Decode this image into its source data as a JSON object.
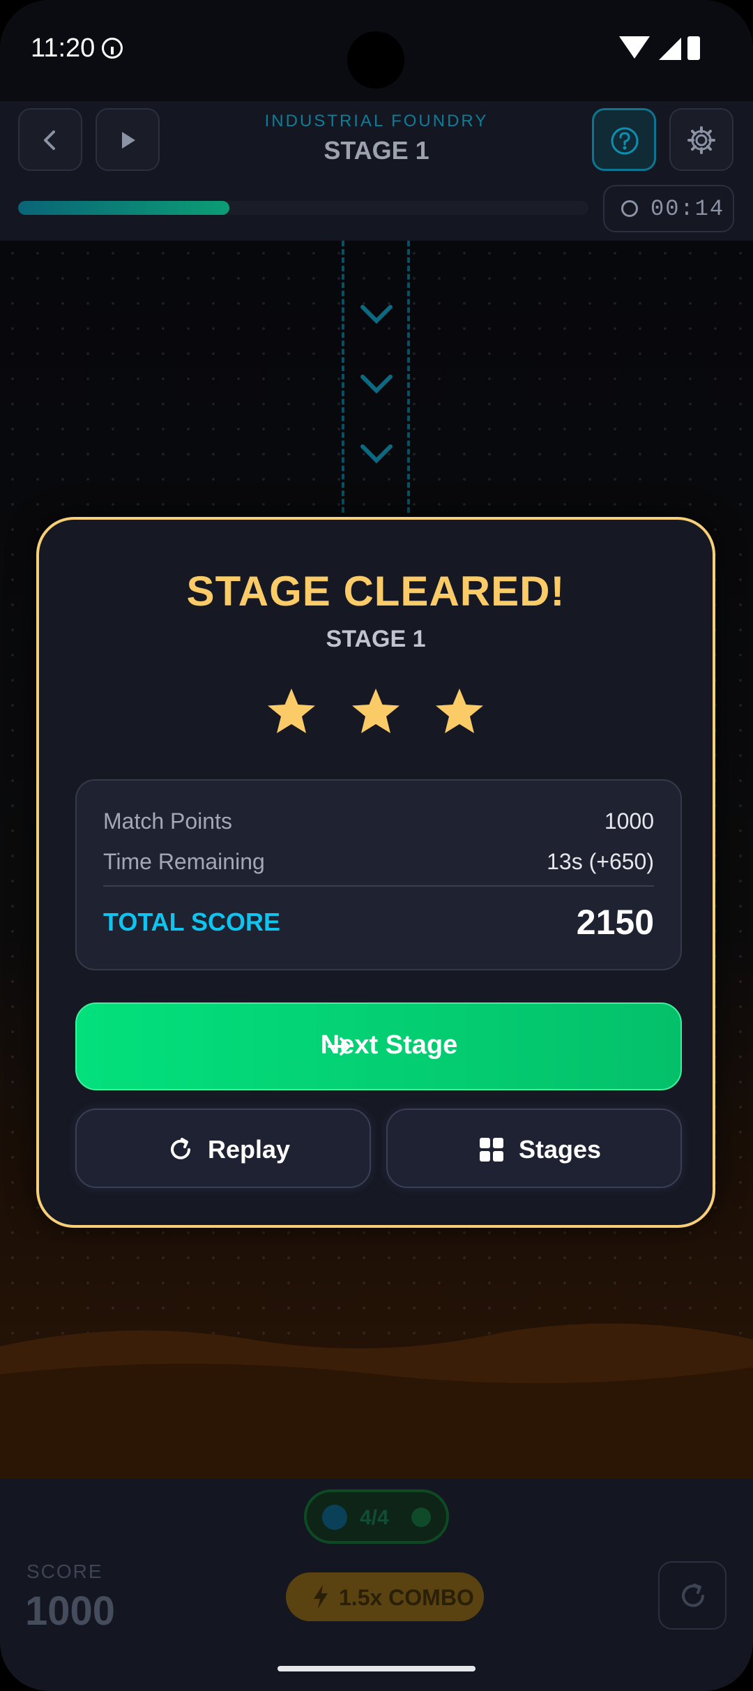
{
  "status_bar": {
    "time": "11:20"
  },
  "header": {
    "world_label": "INDUSTRIAL FOUNDRY",
    "stage_label": "STAGE 1",
    "progress_fraction": 0.37,
    "timer": "00:14"
  },
  "modal": {
    "title": "STAGE CLEARED!",
    "subtitle": "STAGE 1",
    "stars_earned": 3,
    "stars_total": 3,
    "rows": [
      {
        "label": "Match Points",
        "value": "1000"
      },
      {
        "label": "Time Remaining",
        "value": "13s (+650)"
      }
    ],
    "total_label": "TOTAL SCORE",
    "total_value": "2150",
    "next_button": "Next Stage",
    "replay_button": "Replay",
    "stages_button": "Stages"
  },
  "bottom_bar": {
    "score_label": "SCORE",
    "score_value": "1000",
    "piece_count": "4/4",
    "combo_label": "1.5x COMBO"
  },
  "colors": {
    "accent_gold": "#f6cf76",
    "accent_cyan": "#10c4f0",
    "accent_green": "#03e07c"
  },
  "icons": [
    "info-icon",
    "wifi-icon",
    "signal-icon",
    "battery-icon",
    "back-icon",
    "play-icon",
    "help-icon",
    "gear-icon",
    "timer-icon",
    "chevron-down-icon",
    "star-icon",
    "arrow-right-icon",
    "replay-icon",
    "grid-icon",
    "lightning-icon",
    "check-icon",
    "restart-icon"
  ]
}
